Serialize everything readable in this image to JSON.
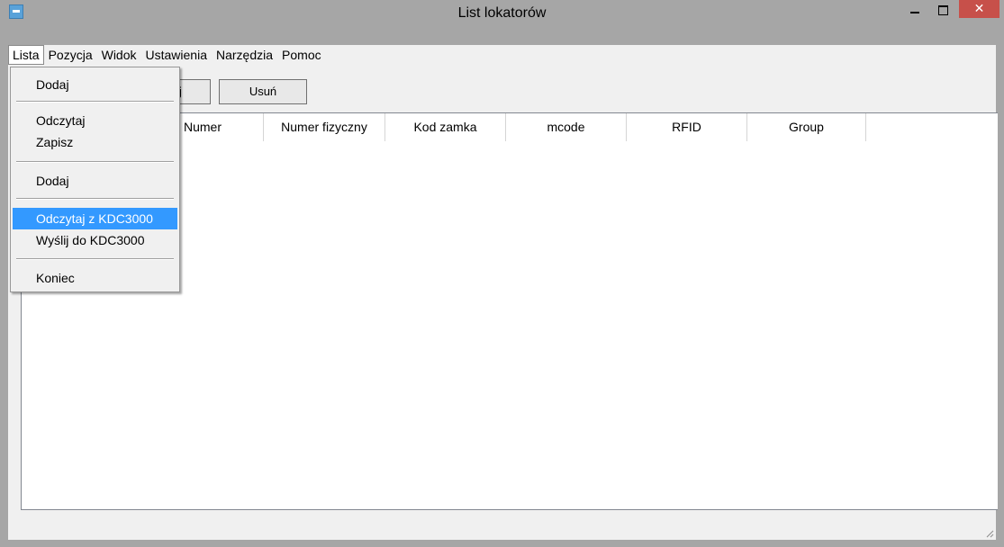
{
  "window": {
    "title": "List lokatorów",
    "close_glyph": "✕"
  },
  "menubar": {
    "items": [
      "Lista",
      "Pozycja",
      "Widok",
      "Ustawienia",
      "Narzędzia",
      "Pomoc"
    ]
  },
  "toolbar": {
    "partial_button_label": "j",
    "delete_label": "Usuń"
  },
  "table": {
    "columns": [
      "Numer",
      "Numer fizyczny",
      "Kod zamka",
      "mcode",
      "RFID",
      "Group"
    ]
  },
  "lista_menu": {
    "items": [
      "Dodaj",
      "Odczytaj",
      "Zapisz",
      "Dodaj",
      "Odczytaj z KDC3000",
      "Wyślij do KDC3000",
      "Koniec"
    ],
    "highlighted_index": 4
  },
  "colors": {
    "highlight": "#3399ff",
    "close_button": "#c7504a",
    "frame": "#a6a6a6"
  }
}
